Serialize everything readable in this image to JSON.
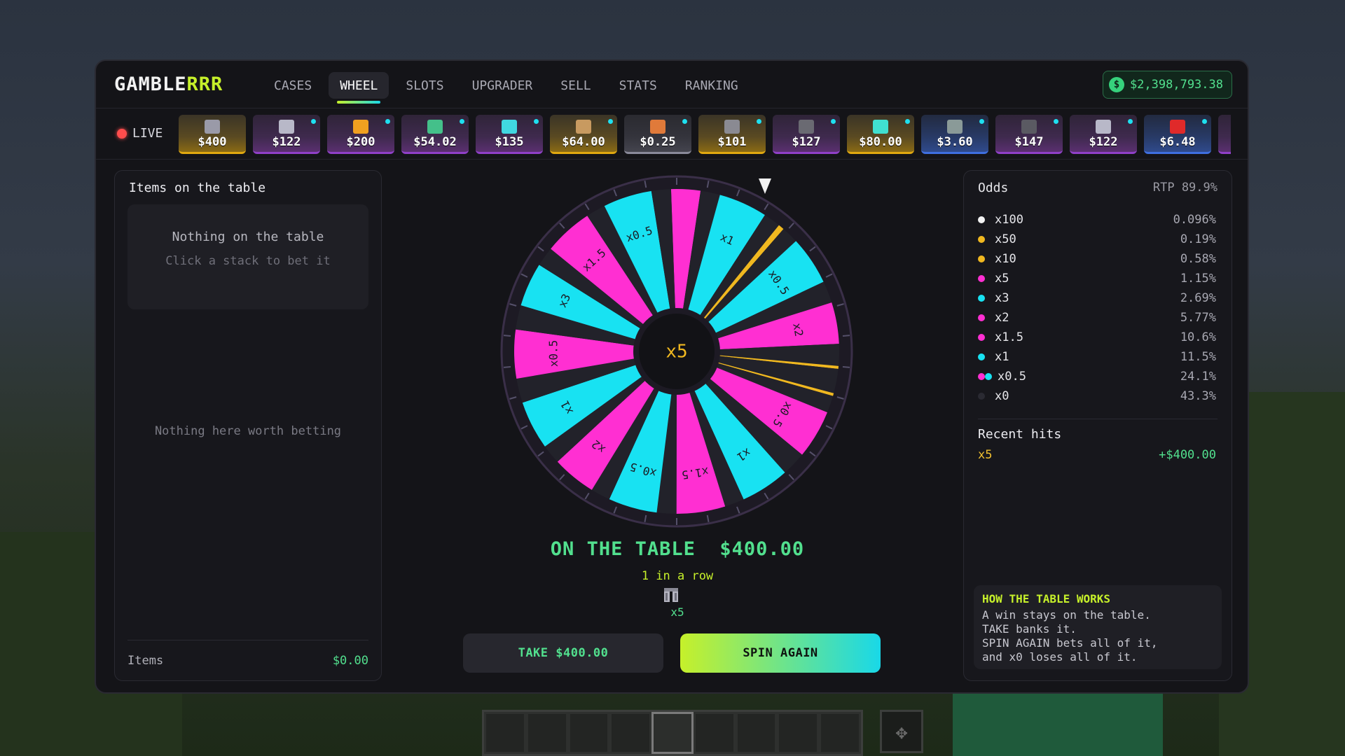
{
  "app": {
    "name_main": "GAMBLE",
    "name_accent": "RRR"
  },
  "nav": {
    "tabs": [
      {
        "label": "CASES"
      },
      {
        "label": "WHEEL",
        "active": true
      },
      {
        "label": "SLOTS"
      },
      {
        "label": "UPGRADER"
      },
      {
        "label": "SELL"
      },
      {
        "label": "STATS"
      },
      {
        "label": "RANKING"
      }
    ]
  },
  "balance": {
    "icon": "dollar-coin-icon",
    "amount": "$2,398,793.38"
  },
  "live": {
    "label": "LIVE",
    "drops": [
      {
        "value": "$400",
        "rarity": "gold",
        "icon": "armor-leggings-icon",
        "color": "#9a9aa8"
      },
      {
        "value": "$122",
        "rarity": "purple",
        "icon": "sword-icon",
        "color": "#b8b8c8"
      },
      {
        "value": "$200",
        "rarity": "purple",
        "icon": "golden-apple-icon",
        "color": "#f0a020"
      },
      {
        "value": "$54.02",
        "rarity": "purple",
        "icon": "pickaxe-icon",
        "color": "#44c08a"
      },
      {
        "value": "$135",
        "rarity": "purple",
        "icon": "diamond-block-icon",
        "color": "#40d8e0"
      },
      {
        "value": "$64.00",
        "rarity": "gold",
        "icon": "cookie-icon",
        "color": "#c89a60"
      },
      {
        "value": "$0.25",
        "rarity": "gray",
        "icon": "brick-icon",
        "color": "#e07a3a"
      },
      {
        "value": "$101",
        "rarity": "gold",
        "icon": "stone-block-icon",
        "color": "#8a8a92"
      },
      {
        "value": "$127",
        "rarity": "purple",
        "icon": "pickaxe-icon",
        "color": "#6a6a72"
      },
      {
        "value": "$80.00",
        "rarity": "gold",
        "icon": "diamond-icon",
        "color": "#40e0d0"
      },
      {
        "value": "$3.60",
        "rarity": "blue",
        "icon": "stone-block-icon",
        "color": "#8a9a98"
      },
      {
        "value": "$147",
        "rarity": "purple",
        "icon": "boots-icon",
        "color": "#5a5a62"
      },
      {
        "value": "$122",
        "rarity": "purple",
        "icon": "sword-icon",
        "color": "#b8b8c8"
      },
      {
        "value": "$6.48",
        "rarity": "blue",
        "icon": "apple-icon",
        "color": "#e02a2a"
      },
      {
        "value": "$",
        "rarity": "purple",
        "icon": "item-icon",
        "color": "#888888"
      }
    ]
  },
  "table_panel": {
    "title": "Items on the table",
    "empty_title": "Nothing on the table",
    "empty_sub": "Click a stack to bet it",
    "nothing_worth": "Nothing here worth betting",
    "footer_label": "Items",
    "footer_value": "$0.00"
  },
  "wheel": {
    "center_label": "x5",
    "colors": {
      "pink": "#ff2fd2",
      "cyan": "#18e2f2",
      "gold": "#f0b820",
      "dark": "#22222a"
    },
    "segments": [
      {
        "label": "",
        "color": "pink",
        "weight": 0.6
      },
      {
        "label": "",
        "color": "dark",
        "weight": 0.4
      },
      {
        "label": "x1",
        "color": "cyan",
        "weight": 1
      },
      {
        "label": "",
        "color": "dark",
        "weight": 0.35
      },
      {
        "label": "",
        "color": "gold",
        "weight": 0.12
      },
      {
        "label": "",
        "color": "dark",
        "weight": 0.35
      },
      {
        "label": "x0.5",
        "color": "cyan",
        "weight": 1
      },
      {
        "label": "",
        "color": "dark",
        "weight": 0.45
      },
      {
        "label": "x2",
        "color": "pink",
        "weight": 0.85
      },
      {
        "label": "",
        "color": "dark",
        "weight": 0.45
      },
      {
        "label": "",
        "color": "gold",
        "weight": 0.06
      },
      {
        "label": "",
        "color": "dark",
        "weight": 0.5
      },
      {
        "label": "",
        "color": "gold",
        "weight": 0.06
      },
      {
        "label": "",
        "color": "dark",
        "weight": 0.35
      },
      {
        "label": "x0.5",
        "color": "pink",
        "weight": 1
      },
      {
        "label": "",
        "color": "dark",
        "weight": 0.5
      },
      {
        "label": "x1",
        "color": "cyan",
        "weight": 1
      },
      {
        "label": "",
        "color": "dark",
        "weight": 0.4
      },
      {
        "label": "x1.5",
        "color": "pink",
        "weight": 1
      },
      {
        "label": "",
        "color": "dark",
        "weight": 0.4
      },
      {
        "label": "x0.5",
        "color": "cyan",
        "weight": 1
      },
      {
        "label": "",
        "color": "dark",
        "weight": 0.4
      },
      {
        "label": "x2",
        "color": "pink",
        "weight": 0.9
      },
      {
        "label": "",
        "color": "dark",
        "weight": 0.4
      },
      {
        "label": "x1",
        "color": "cyan",
        "weight": 1
      },
      {
        "label": "",
        "color": "dark",
        "weight": 0.5
      },
      {
        "label": "x0.5",
        "color": "pink",
        "weight": 1
      },
      {
        "label": "",
        "color": "dark",
        "weight": 0.5
      },
      {
        "label": "x3",
        "color": "cyan",
        "weight": 0.9
      },
      {
        "label": "",
        "color": "dark",
        "weight": 0.4
      },
      {
        "label": "x1.5",
        "color": "pink",
        "weight": 1
      },
      {
        "label": "",
        "color": "dark",
        "weight": 0.4
      },
      {
        "label": "x0.5",
        "color": "cyan",
        "weight": 1
      },
      {
        "label": "",
        "color": "dark",
        "weight": 0.4
      }
    ]
  },
  "result": {
    "on_table_label": "ON THE TABLE",
    "on_table_value": "$400.00",
    "streak": "1 in a row",
    "streak_icon": "armor-leggings-icon",
    "streak_mult": "x5"
  },
  "buttons": {
    "take": "TAKE $400.00",
    "spin": "SPIN AGAIN"
  },
  "odds": {
    "title": "Odds",
    "rtp": "RTP 89.9%",
    "rows": [
      {
        "mult": "x100",
        "pct": "0.096%",
        "color": "#f2f2f2"
      },
      {
        "mult": "x50",
        "pct": "0.19%",
        "color": "#f0b820"
      },
      {
        "mult": "x10",
        "pct": "0.58%",
        "color": "#f0b820"
      },
      {
        "mult": "x5",
        "pct": "1.15%",
        "color": "#ff2fd2"
      },
      {
        "mult": "x3",
        "pct": "2.69%",
        "color": "#18e2f2"
      },
      {
        "mult": "x2",
        "pct": "5.77%",
        "color": "#ff2fd2"
      },
      {
        "mult": "x1.5",
        "pct": "10.6%",
        "color": "#ff2fd2"
      },
      {
        "mult": "x1",
        "pct": "11.5%",
        "color": "#18e2f2"
      },
      {
        "mult": "x0.5",
        "pct": "24.1%",
        "color": "#ff2fd2",
        "color2": "#18e2f2"
      },
      {
        "mult": "x0",
        "pct": "43.3%",
        "color": "#2a2a32"
      }
    ]
  },
  "recent": {
    "title": "Recent hits",
    "mult": "x5",
    "value": "+$400.00"
  },
  "how": {
    "title": "HOW THE TABLE WORKS",
    "lines": [
      "A win stays on the table.",
      "TAKE banks it.",
      "SPIN AGAIN bets all of it,",
      "and x0 loses all of it."
    ]
  }
}
